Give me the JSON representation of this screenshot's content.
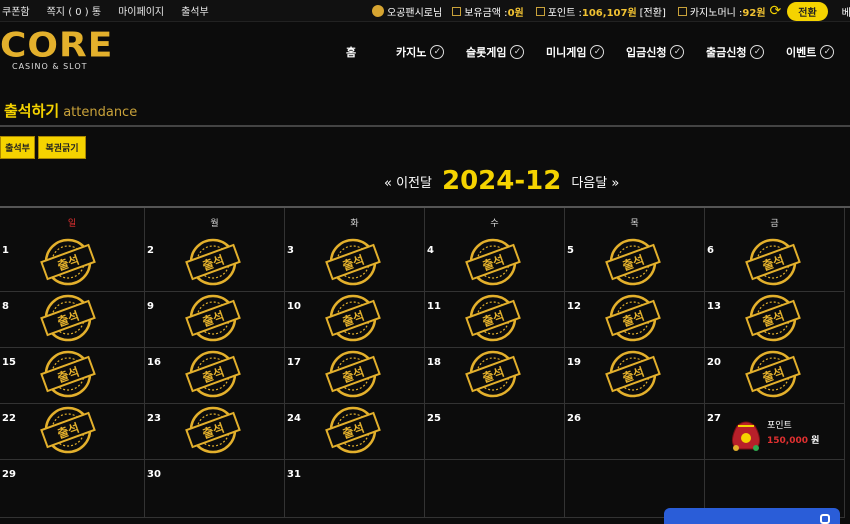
{
  "topbar": {
    "links": [
      "쿠폰함",
      "쪽지 ( 0 ) 통",
      "마이페이지",
      "출석부"
    ],
    "user": "오공팬시로님",
    "balance_label": "보유금액 :",
    "balance_value": "0원",
    "point_label": "포인트 :",
    "point_value": "106,107원",
    "point_exchange": "[전환]",
    "casino_money_label": "카지노머니 :",
    "casino_money_value": "92원",
    "exchange_button": "전환",
    "betting_link": "베팅내"
  },
  "logo": {
    "main": "CORE",
    "sub": "CASINO & SLOT"
  },
  "nav": [
    {
      "label": "홈",
      "check": false
    },
    {
      "label": "카지노",
      "check": true
    },
    {
      "label": "슬롯게임",
      "check": true
    },
    {
      "label": "미니게임",
      "check": true
    },
    {
      "label": "입금신청",
      "check": true
    },
    {
      "label": "출금신청",
      "check": true
    },
    {
      "label": "이벤트",
      "check": true
    }
  ],
  "page": {
    "title": "출석하기",
    "subtitle": "attendance"
  },
  "tabs": [
    "출석부",
    "복권긁기"
  ],
  "month": {
    "prev": "이전달",
    "current": "2024-12",
    "next": "다음달"
  },
  "weekdays": [
    "일",
    "월",
    "화",
    "수",
    "목",
    "금"
  ],
  "stamp_text": "출석",
  "reward": {
    "label": "포인트",
    "amount": "150,000",
    "unit": "원"
  },
  "days": [
    {
      "n": "1",
      "stamp": true
    },
    {
      "n": "2",
      "stamp": true
    },
    {
      "n": "3",
      "stamp": true
    },
    {
      "n": "4",
      "stamp": true
    },
    {
      "n": "5",
      "stamp": true
    },
    {
      "n": "6",
      "stamp": true
    },
    {
      "n": "8",
      "stamp": true
    },
    {
      "n": "9",
      "stamp": true
    },
    {
      "n": "10",
      "stamp": true
    },
    {
      "n": "11",
      "stamp": true
    },
    {
      "n": "12",
      "stamp": true
    },
    {
      "n": "13",
      "stamp": true
    },
    {
      "n": "15",
      "stamp": true
    },
    {
      "n": "16",
      "stamp": true
    },
    {
      "n": "17",
      "stamp": true
    },
    {
      "n": "18",
      "stamp": true
    },
    {
      "n": "19",
      "stamp": true
    },
    {
      "n": "20",
      "stamp": true
    },
    {
      "n": "22",
      "stamp": true
    },
    {
      "n": "23",
      "stamp": true
    },
    {
      "n": "24",
      "stamp": true
    },
    {
      "n": "25",
      "stamp": false
    },
    {
      "n": "26",
      "stamp": false
    },
    {
      "n": "27",
      "stamp": false,
      "reward": true
    },
    {
      "n": "29",
      "stamp": false
    },
    {
      "n": "30",
      "stamp": false
    },
    {
      "n": "31",
      "stamp": false
    },
    {
      "n": "",
      "stamp": false
    },
    {
      "n": "",
      "stamp": false
    },
    {
      "n": "",
      "stamp": false
    }
  ],
  "colors": {
    "accent": "#f5d300",
    "sunday": "#e03030",
    "chat": "#2a5dd8"
  }
}
